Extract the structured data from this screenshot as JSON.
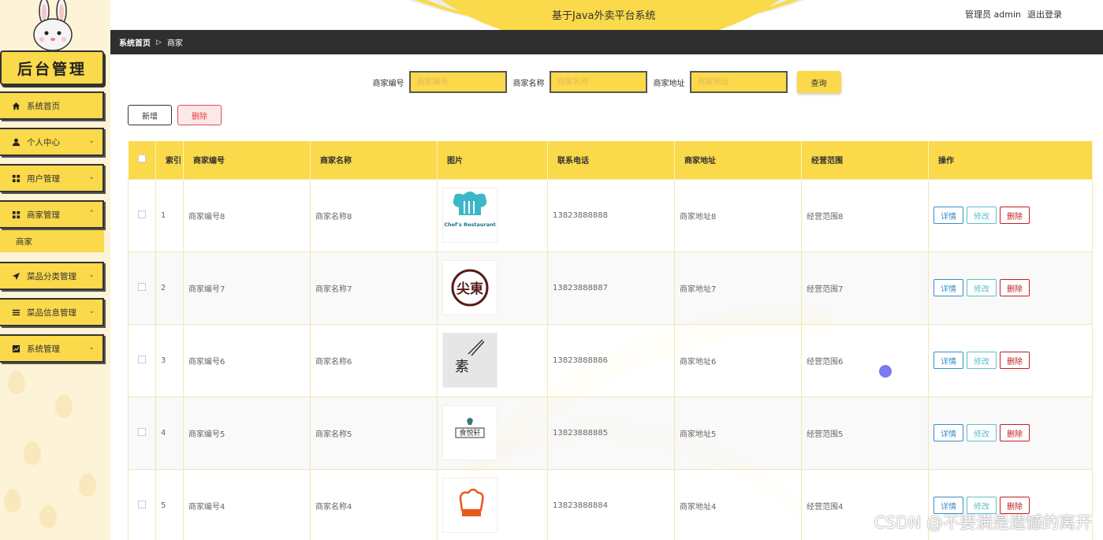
{
  "app": {
    "title": "基于Java外卖平台系统",
    "user_label": "管理员 admin",
    "logout_label": "退出登录",
    "logo_text": "后台管理"
  },
  "sidebar": {
    "items": [
      {
        "label": "系统首页",
        "icon": "home-icon"
      },
      {
        "label": "个人中心",
        "icon": "user-icon"
      },
      {
        "label": "用户管理",
        "icon": "grid-icon"
      },
      {
        "label": "商家管理",
        "icon": "grid-icon"
      },
      {
        "label": "菜品分类管理",
        "icon": "send-icon"
      },
      {
        "label": "菜品信息管理",
        "icon": "list-icon"
      },
      {
        "label": "系统管理",
        "icon": "chart-icon"
      }
    ],
    "sub_item": "商家"
  },
  "breadcrumb": {
    "home": "系统首页",
    "current": "商家"
  },
  "search": {
    "fields": [
      {
        "label": "商家编号",
        "placeholder": "商家编号"
      },
      {
        "label": "商家名称",
        "placeholder": "商家名称"
      },
      {
        "label": "商家地址",
        "placeholder": "商家地址"
      }
    ],
    "button": "查询"
  },
  "toolbar": {
    "add": "新增",
    "delete": "删除"
  },
  "table": {
    "headers": [
      "索引",
      "商家编号",
      "商家名称",
      "图片",
      "联系电话",
      "商家地址",
      "经营范围",
      "操作"
    ],
    "rows": [
      {
        "index": "1",
        "code": "商家编号8",
        "name": "商家名称8",
        "phone": "13823888888",
        "address": "商家地址8",
        "scope": "经营范围8",
        "logo": "chefs-restaurant-logo",
        "logo_text": "Chef's Restaurant"
      },
      {
        "index": "2",
        "code": "商家编号7",
        "name": "商家名称7",
        "phone": "13823888887",
        "address": "商家地址7",
        "scope": "经营范围7",
        "logo": "seal-logo",
        "logo_text": "尖東"
      },
      {
        "index": "3",
        "code": "商家编号6",
        "name": "商家名称6",
        "phone": "13823888886",
        "address": "商家地址6",
        "scope": "经营范围6",
        "logo": "chopsticks-logo",
        "logo_text": "素"
      },
      {
        "index": "4",
        "code": "商家编号5",
        "name": "商家名称5",
        "phone": "13823888885",
        "address": "商家地址5",
        "scope": "经营范围5",
        "logo": "pavilion-logo",
        "logo_text": "食悦轩"
      },
      {
        "index": "5",
        "code": "商家编号4",
        "name": "商家名称4",
        "phone": "13823888884",
        "address": "商家地址4",
        "scope": "经营范围4",
        "logo": "chef-hat-logo",
        "logo_text": ""
      }
    ],
    "ops": {
      "detail": "详情",
      "edit": "修改",
      "delete": "删除"
    }
  },
  "watermark": "CSDN @不要满是遗憾的离开",
  "colors": {
    "accent": "#fad94a",
    "dark": "#2f2f2f",
    "danger": "#c02020",
    "info": "#3a8ec8"
  }
}
